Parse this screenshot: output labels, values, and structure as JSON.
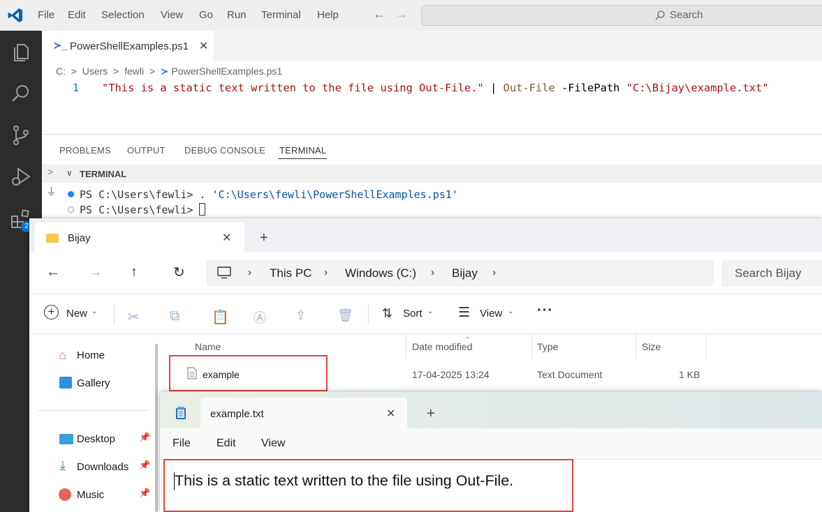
{
  "vscode": {
    "menu": [
      "File",
      "Edit",
      "Selection",
      "View",
      "Go",
      "Run",
      "Terminal",
      "Help"
    ],
    "search_label": "Search",
    "tab_title": "PowerShellExamples.ps1",
    "breadcrumb": [
      "C:",
      "Users",
      "fewli",
      "PowerShellExamples.ps1"
    ],
    "code_line_number": "1",
    "code": {
      "string1": "\"This is a static text written to the file using Out-File.\"",
      "pipe": "|",
      "cmdlet": "Out-File",
      "param": "-FilePath",
      "string2": "\"C:\\Bijay\\example.txt\""
    },
    "panel_tabs": [
      "PROBLEMS",
      "OUTPUT",
      "DEBUG CONSOLE",
      "TERMINAL"
    ],
    "terminal_header": "TERMINAL",
    "terminal_lines": [
      {
        "prompt": "PS C:\\Users\\fewli>",
        "command": ". 'C:\\Users\\fewli\\PowerShellExamples.ps1'"
      },
      {
        "prompt": "PS C:\\Users\\fewli>",
        "command": ""
      }
    ],
    "badge": "2"
  },
  "explorer": {
    "tab_title": "Bijay",
    "address": [
      "This PC",
      "Windows (C:)",
      "Bijay"
    ],
    "search_placeholder": "Search Bijay",
    "commands": {
      "new": "New",
      "sort": "Sort",
      "view": "View"
    },
    "nav": [
      {
        "label": "Home",
        "icon": "home-icon"
      },
      {
        "label": "Gallery",
        "icon": "gallery-icon"
      },
      {
        "label": "Desktop",
        "icon": "desktop-icon"
      },
      {
        "label": "Downloads",
        "icon": "downloads-icon"
      },
      {
        "label": "Music",
        "icon": "music-icon"
      }
    ],
    "columns": [
      "Name",
      "Date modified",
      "Type",
      "Size"
    ],
    "rows": [
      {
        "name": "example",
        "date": "17-04-2025 13:24",
        "type": "Text Document",
        "size": "1 KB"
      }
    ]
  },
  "notepad": {
    "tab_title": "example.txt",
    "menu": [
      "File",
      "Edit",
      "View"
    ],
    "content": "This is a static text written to the file using Out-File."
  },
  "colors": {
    "vscode_blue": "#0065a9",
    "string_red": "#a31515",
    "highlight_red": "#e0443e",
    "activity_bar": "#2c2c2c"
  }
}
